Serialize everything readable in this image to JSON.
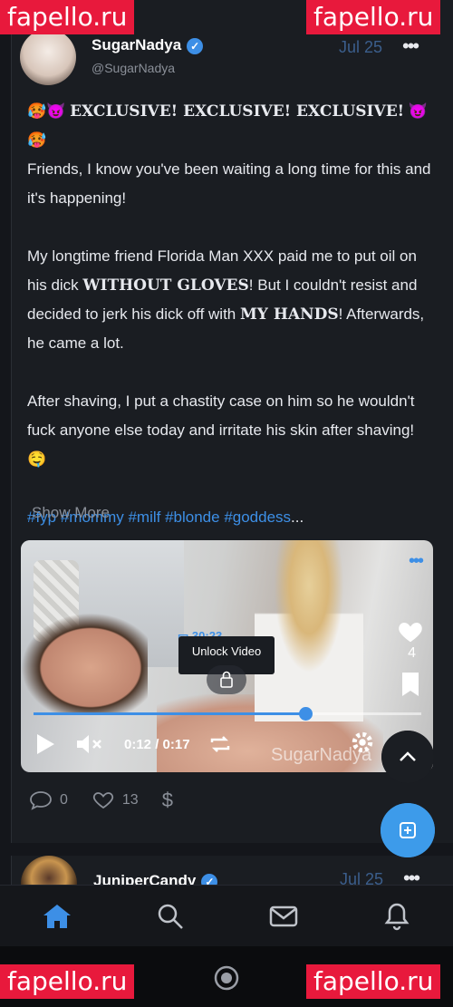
{
  "watermarks": [
    "fapello.ru",
    "fapello.ru",
    "fapello.ru",
    "fapello.ru"
  ],
  "post": {
    "author": "SugarNadya",
    "handle": "@SugarNadya",
    "date": "Jul 25",
    "more_icon": "•••",
    "lines": {
      "headline_emoji_left": "🥵😈",
      "headline": "EXCLUSIVE! EXCLUSIVE! EXCLUSIVE!",
      "headline_emoji_right": "😈🥵",
      "p1": "Friends, I know you've been waiting a long time for this and it's happening!",
      "p2_a": "My longtime friend Florida Man XXX paid me to put oil on his dick ",
      "p2_bold1": "WITHOUT GLOVES",
      "p2_b": "! But I couldn't resist and decided to jerk his dick off with ",
      "p2_bold2": "MY HANDS",
      "p2_c": "! Afterwards, he came a lot.",
      "p3": "After shaving, I put a chastity case on him so he wouldn't fuck anyone else today and irritate his skin after shaving! 🤤",
      "tags": "#fyp #mommy #milf #blonde #goddess",
      "ellipsis": "..."
    },
    "show_more": "Show More",
    "video": {
      "duration": "30:23",
      "unlock_label": "Unlock Video",
      "likes": "4",
      "time": "0:12 / 0:17",
      "progress": 0.7,
      "watermark": "SugarNadya"
    },
    "stats": {
      "comments": "0",
      "likes": "13",
      "tip_icon": "$"
    }
  },
  "next_post": {
    "author": "JuniperCandy",
    "date": "Jul 25",
    "more_icon": "•••"
  },
  "colors": {
    "accent": "#3d8fe6",
    "background": "#14161b",
    "card": "#1a1d22"
  },
  "tabs": [
    "home-icon",
    "search-icon",
    "mail-icon",
    "bell-icon"
  ]
}
